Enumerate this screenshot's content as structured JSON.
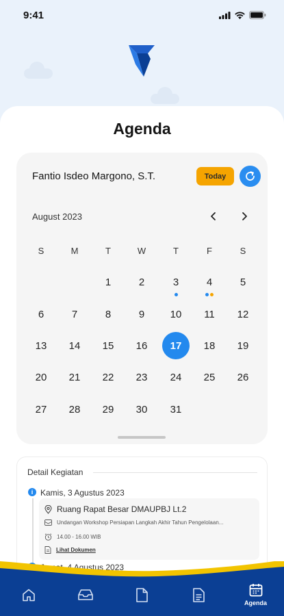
{
  "status_bar": {
    "time": "9:41"
  },
  "page_title": "Agenda",
  "calendar": {
    "user_name": "Fantio Isdeo Margono, S.T.",
    "today_label": "Today",
    "month_label": "August 2023",
    "weekdays": [
      "S",
      "M",
      "T",
      "W",
      "T",
      "F",
      "S"
    ],
    "weeks": [
      [
        "",
        "",
        "1",
        "2",
        "3",
        "4",
        "5"
      ],
      [
        "6",
        "7",
        "8",
        "9",
        "10",
        "11",
        "12"
      ],
      [
        "13",
        "14",
        "15",
        "16",
        "17",
        "18",
        "19"
      ],
      [
        "20",
        "21",
        "22",
        "23",
        "24",
        "25",
        "26"
      ],
      [
        "27",
        "28",
        "29",
        "30",
        "31",
        "",
        ""
      ]
    ],
    "selected_day": "17",
    "event_dots": {
      "3": [
        "#2389ee"
      ],
      "4": [
        "#2389ee",
        "#f5a400"
      ]
    }
  },
  "detail": {
    "title": "Detail Kegiatan",
    "items": [
      {
        "date": "Kamis, 3 Agustus 2023",
        "location": "Ruang Rapat Besar DMAUPBJ Lt.2",
        "description": "Undangan Workshop Persiapan Langkah Akhir Tahun Pengelolaan...",
        "time": "14.00 - 16.00 WIB",
        "document_link": "Lihat Dokumen"
      },
      {
        "date": "Jumat, 4 Agustus 2023"
      }
    ]
  },
  "tabbar": {
    "items": [
      {
        "icon": "home-icon",
        "label": ""
      },
      {
        "icon": "inbox-icon",
        "label": ""
      },
      {
        "icon": "document-icon",
        "label": ""
      },
      {
        "icon": "document-lines-icon",
        "label": ""
      },
      {
        "icon": "calendar-icon",
        "label": "Agenda"
      }
    ]
  },
  "colors": {
    "accent": "#2389ee",
    "today": "#f5a400",
    "navbar": "#0b3f94",
    "wave": "#f2c400"
  }
}
